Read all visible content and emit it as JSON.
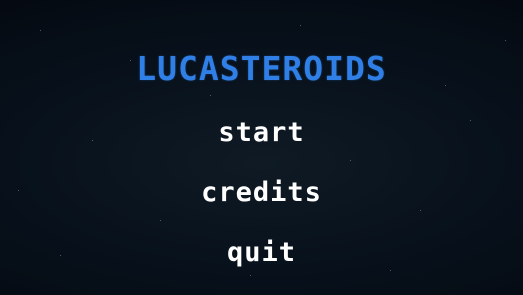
{
  "game": {
    "title": "LUCASTEROIDS"
  },
  "menu": {
    "items": [
      {
        "label": "start"
      },
      {
        "label": "credits"
      },
      {
        "label": "quit"
      }
    ]
  },
  "colors": {
    "title": "#2f7fe6",
    "menu_text": "#ffffff",
    "background": "#07101a"
  }
}
